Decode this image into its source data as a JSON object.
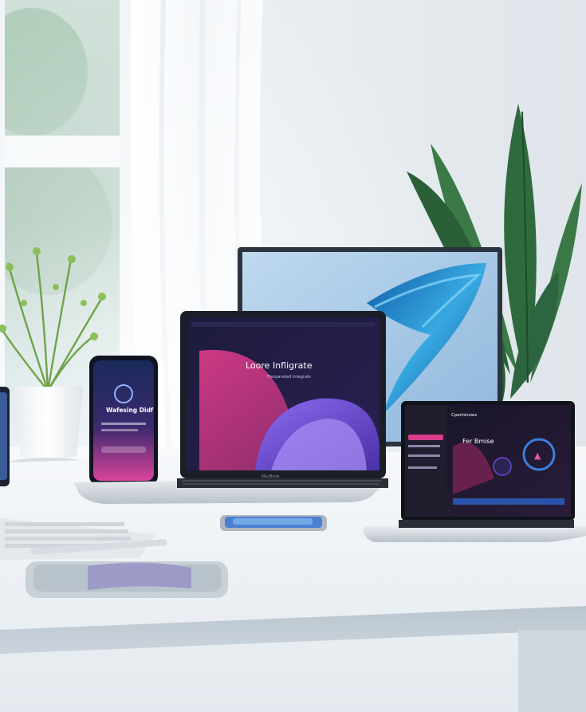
{
  "scene": {
    "colors": {
      "wall": "#e6ebef",
      "desk": "#f3f6f9",
      "accent_blue": "#2f8fd0",
      "accent_pink": "#d83c8a",
      "accent_purple": "#6b4ad6",
      "screen_dark": "#14142a"
    },
    "laptop_center": {
      "headline": "Loore Infligrate",
      "subhead": "Flexpaneled Integrate"
    },
    "phone_left": {
      "headline": "Wafesing Didf"
    },
    "laptop_right": {
      "title": "Cpertshows",
      "headline": "Fer Bmise"
    },
    "laptop_brand": "MacBook"
  }
}
